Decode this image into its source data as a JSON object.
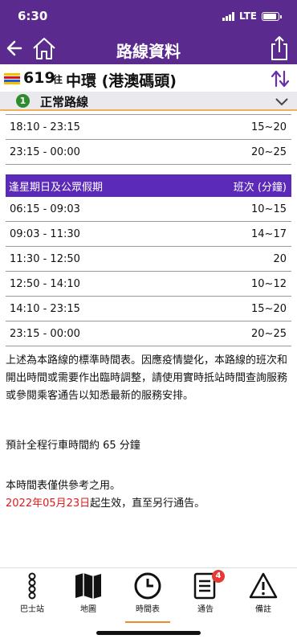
{
  "status": {
    "time": "6:30",
    "network": "LTE"
  },
  "nav": {
    "title": "路線資料"
  },
  "route": {
    "number": "619",
    "to": "往",
    "destination": "中環 (港澳碼頭)"
  },
  "variant": {
    "index": "1",
    "label": "正常路線"
  },
  "schedule_top": [
    {
      "time": "18:10 - 23:15",
      "freq": "15~20"
    },
    {
      "time": "23:15 - 00:00",
      "freq": "20~25"
    }
  ],
  "holiday_section": {
    "title": "逢星期日及公眾假期",
    "freq_header": "班次 (分鐘)",
    "rows": [
      {
        "time": "06:15 - 09:03",
        "freq": "10~15"
      },
      {
        "time": "09:03 - 11:30",
        "freq": "14~17"
      },
      {
        "time": "11:30 - 12:50",
        "freq": "20"
      },
      {
        "time": "12:50 - 14:10",
        "freq": "10~12"
      },
      {
        "time": "14:10 - 23:15",
        "freq": "15~20"
      },
      {
        "time": "23:15 - 00:00",
        "freq": "20~25"
      }
    ]
  },
  "notes": {
    "p1": "上述為本路線的標準時間表。因應疫情變化，本路線的班次和開出時間或需要作出臨時調整，請使用實時抵站時間查詢服務或參閱乘客通告以知悉最新的服務安排。",
    "p2": "預計全程行車時間約 65 分鐘",
    "p3": "本時間表僅供參考之用。",
    "effective_date": "2022年05月23日",
    "effective_suffix": "起生效，直至另行通告。"
  },
  "tabs": {
    "stops": "巴士站",
    "map": "地圖",
    "timetable": "時間表",
    "notice": "通告",
    "notice_badge": "4",
    "remarks": "備註"
  },
  "colors": {
    "header": "#5b2a8e",
    "section": "#5b2ab8",
    "accent": "#f08a2a",
    "date": "#e0191e"
  }
}
